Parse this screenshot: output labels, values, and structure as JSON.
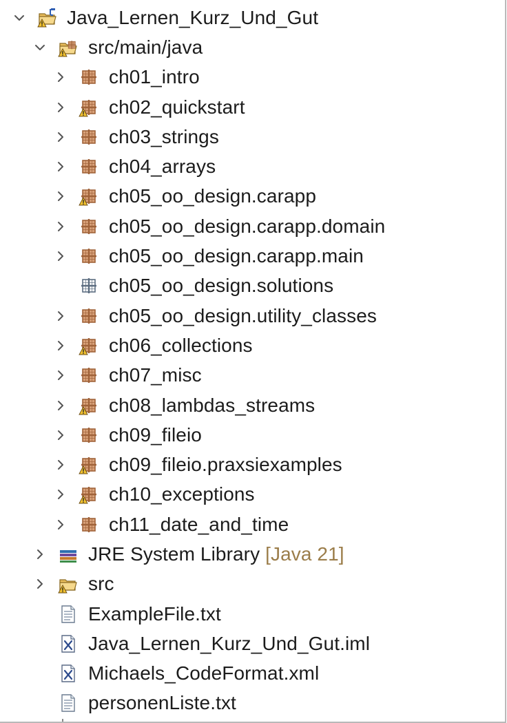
{
  "project": {
    "name": "Java_Lernen_Kurz_Und_Gut",
    "icon": "java-project-warning-icon",
    "twisty": "chevron-down-icon"
  },
  "source_folder": {
    "name": "src/main/java",
    "icon": "source-folder-warning-icon",
    "twisty": "chevron-down-icon"
  },
  "packages": [
    {
      "name": "ch01_intro",
      "icon": "package-icon",
      "twisty": "chevron-right-icon"
    },
    {
      "name": "ch02_quickstart",
      "icon": "package-warning-icon",
      "twisty": "chevron-right-icon"
    },
    {
      "name": "ch03_strings",
      "icon": "package-icon",
      "twisty": "chevron-right-icon"
    },
    {
      "name": "ch04_arrays",
      "icon": "package-icon",
      "twisty": "chevron-right-icon"
    },
    {
      "name": "ch05_oo_design.carapp",
      "icon": "package-warning-icon",
      "twisty": "chevron-right-icon"
    },
    {
      "name": "ch05_oo_design.carapp.domain",
      "icon": "package-icon",
      "twisty": "chevron-right-icon"
    },
    {
      "name": "ch05_oo_design.carapp.main",
      "icon": "package-icon",
      "twisty": "chevron-right-icon"
    },
    {
      "name": "ch05_oo_design.solutions",
      "icon": "empty-package-icon",
      "twisty": ""
    },
    {
      "name": "ch05_oo_design.utility_classes",
      "icon": "package-icon",
      "twisty": "chevron-right-icon"
    },
    {
      "name": "ch06_collections",
      "icon": "package-warning-icon",
      "twisty": "chevron-right-icon"
    },
    {
      "name": "ch07_misc",
      "icon": "package-icon",
      "twisty": "chevron-right-icon"
    },
    {
      "name": "ch08_lambdas_streams",
      "icon": "package-warning-icon",
      "twisty": "chevron-right-icon"
    },
    {
      "name": "ch09_fileio",
      "icon": "package-icon",
      "twisty": "chevron-right-icon"
    },
    {
      "name": "ch09_fileio.praxsiexamples",
      "icon": "package-warning-icon",
      "twisty": "chevron-right-icon"
    },
    {
      "name": "ch10_exceptions",
      "icon": "package-warning-icon",
      "twisty": "chevron-right-icon"
    },
    {
      "name": "ch11_date_and_time",
      "icon": "package-icon",
      "twisty": "chevron-right-icon"
    }
  ],
  "library": {
    "name": "JRE System Library",
    "decoration": "[Java 21]",
    "icon": "library-icon",
    "twisty": "chevron-right-icon"
  },
  "src_folder": {
    "name": "src",
    "icon": "folder-warning-icon",
    "twisty": "chevron-right-icon"
  },
  "files": [
    {
      "name": "ExampleFile.txt",
      "icon": "text-file-icon"
    },
    {
      "name": "Java_Lernen_Kurz_Und_Gut.iml",
      "icon": "xml-file-icon"
    },
    {
      "name": "Michaels_CodeFormat.xml",
      "icon": "xml-file-icon"
    },
    {
      "name": "personenListe.txt",
      "icon": "text-file-icon"
    }
  ],
  "colors": {
    "package_brown": "#a0633a",
    "warning_yellow": "#f2c230",
    "decoration_text": "#9b7d4a",
    "folder_yellow": "#e9bd5c"
  }
}
